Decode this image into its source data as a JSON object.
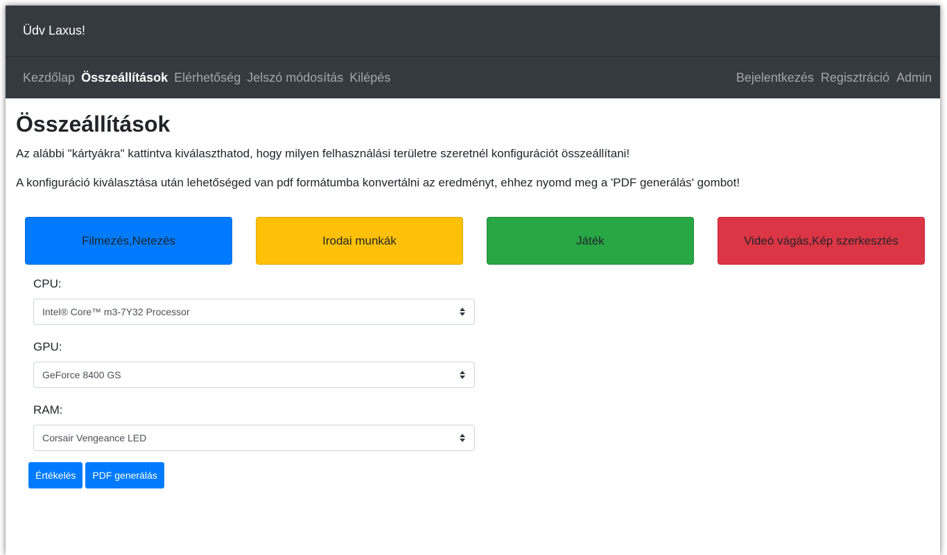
{
  "header": {
    "greeting": "Üdv Laxus!"
  },
  "nav": {
    "left": [
      {
        "label": "Kezdőlap",
        "active": false
      },
      {
        "label": "Összeállítások",
        "active": true
      },
      {
        "label": "Elérhetőség",
        "active": false
      },
      {
        "label": "Jelszó módosítás",
        "active": false
      },
      {
        "label": "Kilépés",
        "active": false
      }
    ],
    "right": [
      {
        "label": "Bejelentkezés"
      },
      {
        "label": "Regisztráció"
      },
      {
        "label": "Admin"
      }
    ]
  },
  "main": {
    "title": "Összeállítások",
    "paragraph1": "Az alábbi \"kártyákra\" kattintva kiválaszthatod, hogy milyen felhasználási területre szeretnél konfigurációt összeállítani!",
    "paragraph2": "A konfiguráció kiválasztása után lehetőséged van pdf formátumba konvertálni az eredményt, ehhez nyomd meg a 'PDF generálás' gombot!",
    "cards": [
      {
        "label": "Filmezés,Netezés",
        "color": "#007bff"
      },
      {
        "label": "Irodai munkák",
        "color": "#ffc107"
      },
      {
        "label": "Játék",
        "color": "#28a745"
      },
      {
        "label": "Videó vágás,Kép szerkesztés",
        "color": "#dc3545"
      }
    ]
  },
  "form": {
    "cpu": {
      "label": "CPU:",
      "value": "Intel® Core™ m3-7Y32 Processor"
    },
    "gpu": {
      "label": "GPU:",
      "value": "GeForce 8400 GS"
    },
    "ram": {
      "label": "RAM:",
      "value": "Corsair Vengeance LED"
    },
    "evaluate_button": "Értékelés",
    "pdf_button": "PDF generálás"
  },
  "colors": {
    "navbar_bg": "#343a40",
    "primary": "#007bff"
  }
}
